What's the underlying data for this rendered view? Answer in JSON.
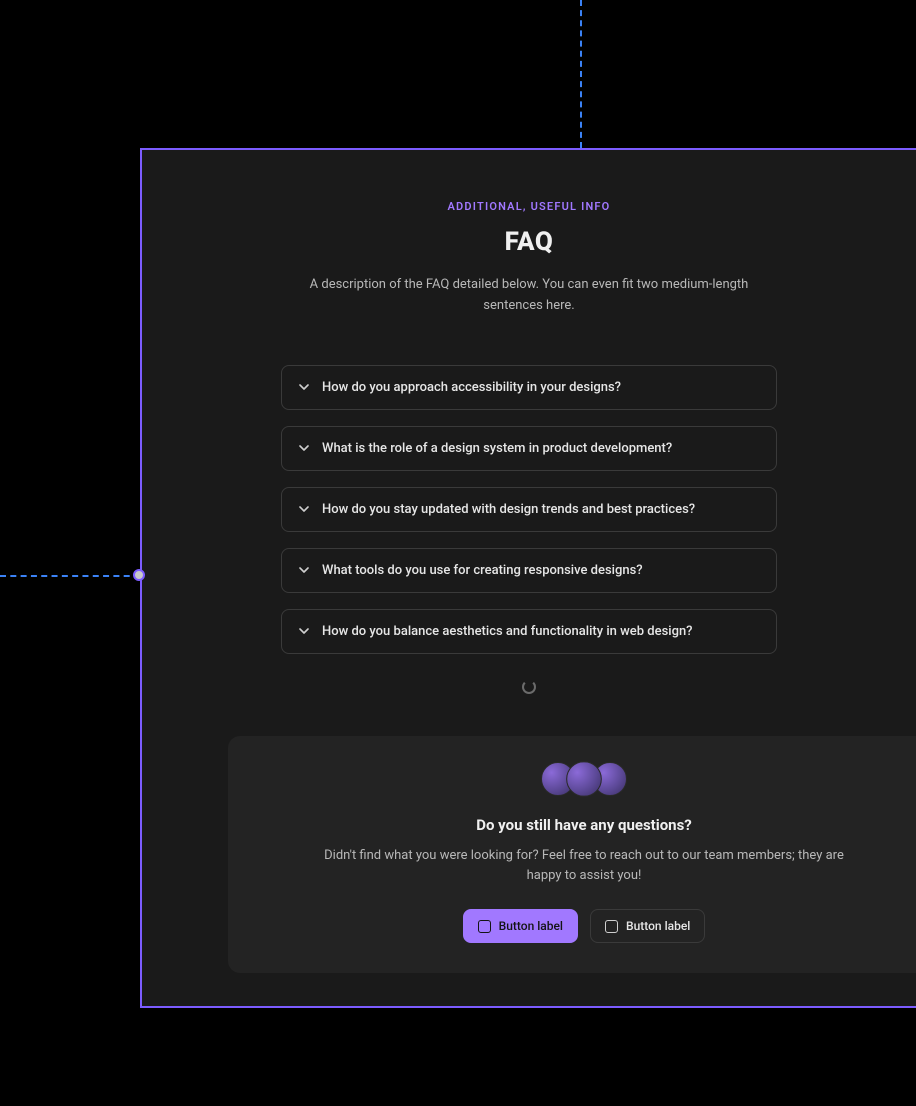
{
  "header": {
    "eyebrow": "ADDITIONAL, USEFUL INFO",
    "title": "FAQ",
    "description": "A description of the FAQ detailed below. You can even fit two medium-length sentences here."
  },
  "faq": [
    {
      "question": "How do you approach accessibility in your designs?"
    },
    {
      "question": "What is the role of a design system in product development?"
    },
    {
      "question": "How do you stay updated with design trends and best practices?"
    },
    {
      "question": "What tools do you use for creating responsive designs?"
    },
    {
      "question": "How do you balance aesthetics and functionality in web design?"
    }
  ],
  "cta": {
    "title": "Do you still have any questions?",
    "subtitle": "Didn't find what you were looking for? Feel free to reach out to our team members; they are happy to assist you!",
    "primary_label": "Button label",
    "secondary_label": "Button label"
  }
}
